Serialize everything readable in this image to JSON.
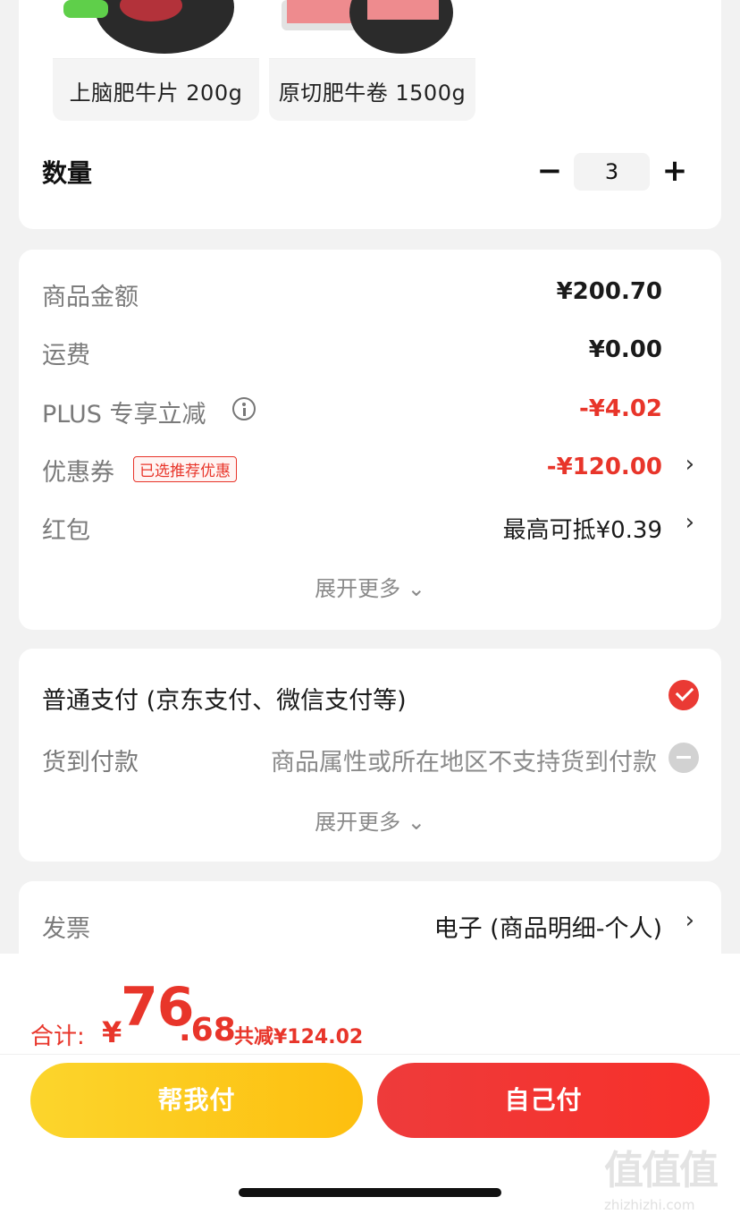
{
  "products": [
    {
      "label": "上脑肥牛片 200g"
    },
    {
      "label": "原切肥牛卷 1500g"
    }
  ],
  "quantity": {
    "label": "数量",
    "value": "3",
    "minus": "−",
    "plus": "+"
  },
  "amount": {
    "goods_label": "商品金额",
    "goods_value": "¥200.70",
    "shipping_label": "运费",
    "shipping_value": "¥0.00",
    "plus_label": "PLUS 专享立减",
    "plus_value": "-¥4.02",
    "coupon_label": "优惠券",
    "coupon_tag": "已选推荐优惠",
    "coupon_value": "-¥120.00",
    "redpack_label": "红包",
    "redpack_value": "最高可抵¥0.39",
    "expand": "展开更多 ⌄",
    "chevron": "›"
  },
  "payment": {
    "normal_label": "普通支付 (京东支付、微信支付等)",
    "cod_label": "货到付款",
    "cod_note": "商品属性或所在地区不支持货到付款",
    "expand": "展开更多 ⌄"
  },
  "invoice": {
    "label": "发票",
    "value": "电子 (商品明细-个人)"
  },
  "total": {
    "label": "合计:",
    "yen": "¥",
    "integer": "76",
    "decimal": ".68",
    "saved": "共减¥124.02"
  },
  "buttons": {
    "help_pay": "帮我付",
    "self_pay": "自己付"
  },
  "watermark": {
    "big": "值值值",
    "small": "zhizhizhi.com"
  },
  "colors": {
    "accent_red": "#e8352a",
    "button_yellow": "#fcd52c",
    "button_red": "#f7302a"
  }
}
